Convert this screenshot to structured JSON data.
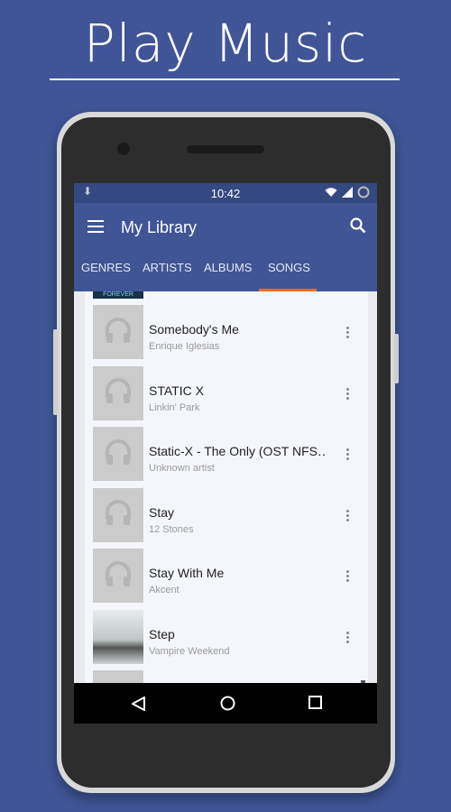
{
  "promo": {
    "title": "Play Music"
  },
  "status_bar": {
    "time": "10:42"
  },
  "app_bar": {
    "title": "My Library"
  },
  "tabs": [
    {
      "label": "GENRES"
    },
    {
      "label": "ARTISTS"
    },
    {
      "label": "ALBUMS"
    },
    {
      "label": "SONGS",
      "active": true
    }
  ],
  "partial_album_text": "FOREVER",
  "songs": [
    {
      "title": "Somebody's Me",
      "artist": "Enrique Iglesias"
    },
    {
      "title": "STATIC X",
      "artist": "Linkin' Park"
    },
    {
      "title": "Static-X - The Only (OST NFS‥",
      "artist": "Unknown artist"
    },
    {
      "title": "Stay",
      "artist": "12 Stones"
    },
    {
      "title": "Stay With Me",
      "artist": "Akcent"
    },
    {
      "title": "Step",
      "artist": "Vampire Weekend"
    }
  ],
  "colors": {
    "background": "#3f5597",
    "app_bar": "#3f5596",
    "status_bar": "#34497f",
    "tab_indicator": "#f26b1d"
  }
}
